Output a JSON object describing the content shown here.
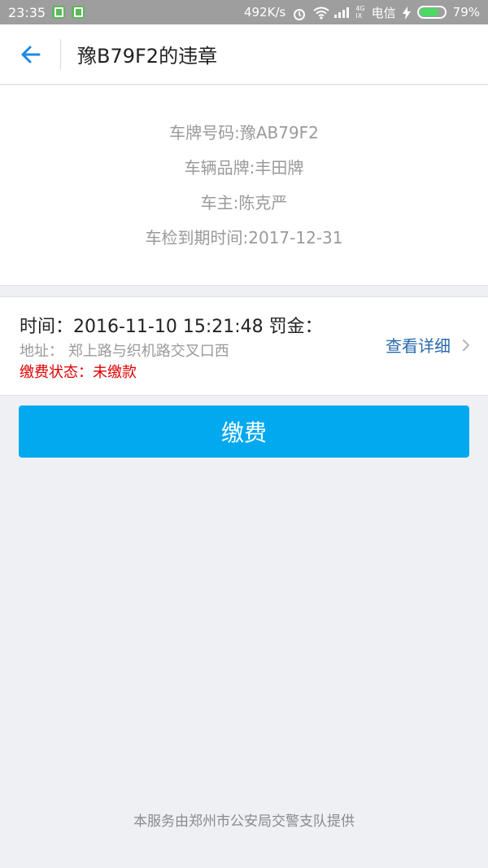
{
  "status_bar": {
    "time": "23:35",
    "net_speed": "492K/s",
    "carrier": "电信",
    "battery": "79%",
    "signal_label_top": "4G",
    "signal_label_bottom": "IX",
    "icons": [
      "app-notification-icon",
      "app-notification-icon",
      "alarm-icon",
      "wifi-icon",
      "signal-icon",
      "charging-icon",
      "battery-icon"
    ],
    "battery_level": 0.79,
    "colors": {
      "background": "#9e9e9e",
      "battery_fill": "#4cd964",
      "notification": "#5cb85c"
    }
  },
  "header": {
    "title": "豫B79F2的违章",
    "back_icon": "arrow-left-icon",
    "colors": {
      "back_arrow": "#1e88e5"
    }
  },
  "vehicle": {
    "plate": "车牌号码:豫AB79F2",
    "brand": "车辆品牌:丰田牌",
    "owner": "车主:陈克严",
    "inspection": "车检到期时间:2017-12-31"
  },
  "violation": {
    "time_and_fine": "时间：2016-11-10 15:21:48 罚金：",
    "address_label": "地址：",
    "address": "郑上路与织机路交叉口西",
    "status_label": "缴费状态：",
    "status_value": "未缴款",
    "detail_link": "查看详细",
    "detail_icon": "chevron-right-icon",
    "colors": {
      "status": "#e00000",
      "link": "#2a6aad"
    }
  },
  "actions": {
    "pay_label": "缴费",
    "colors": {
      "pay_button": "#03a9ef"
    }
  },
  "footer": {
    "note": "本服务由郑州市公安局交警支队提供"
  }
}
